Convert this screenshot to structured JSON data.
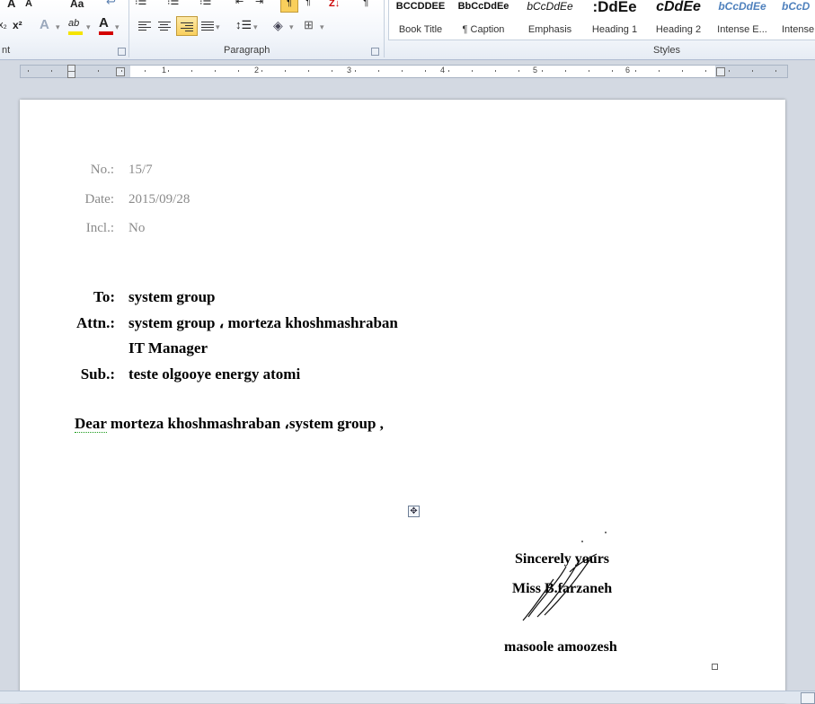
{
  "ribbon": {
    "font_group_label": "nt",
    "paragraph_group_label": "Paragraph",
    "styles_group_label": "Styles",
    "font_buttons": {
      "bold_a": "A",
      "shrink_a": "A",
      "change_case": "Aa",
      "subscript": "x₂",
      "superscript": "x²",
      "text_effects": "A",
      "highlight": "ab",
      "font_color": "A"
    },
    "sort": "Z↓",
    "styles": [
      {
        "sample": "BCCDDEE",
        "name": "Book Title"
      },
      {
        "sample": "BbCcDdEe",
        "name": "¶ Caption"
      },
      {
        "sample": "bCcDdEe",
        "name": "Emphasis"
      },
      {
        "sample": ":DdEe",
        "name": "Heading 1"
      },
      {
        "sample": "cDdEe",
        "name": "Heading 2"
      },
      {
        "sample": "bCcDdEe",
        "name": "Intense E..."
      },
      {
        "sample": "bCcD",
        "name": "Intense"
      }
    ]
  },
  "ruler": {
    "numbers": [
      "1",
      "2",
      "3",
      "4",
      "5",
      "6"
    ]
  },
  "document": {
    "meta": [
      {
        "label": "No.:",
        "value": "15/7"
      },
      {
        "label": "Date:",
        "value": "2015/09/28"
      },
      {
        "label": "Incl.:",
        "value": "No"
      }
    ],
    "header": {
      "to_label": "To:",
      "to_value": "system group",
      "attn_label": "Attn.:",
      "attn_value": "system group ، morteza khoshmashraban",
      "attn_role": "IT Manager",
      "sub_label": "Sub.:",
      "sub_value": "teste olgooye energy atomi"
    },
    "greeting_word": "Dear",
    "greeting_rest": " morteza khoshmashraban ،system group  ,",
    "signature": {
      "closing": "Sincerely yours",
      "name": "Miss B.farzaneh",
      "org": "masoole amoozesh"
    }
  },
  "colors": {
    "meta_text": "#8a8a8a",
    "highlight_yellow": "#f5e400",
    "font_color_red": "#d40000",
    "active_button": "#f9cf5c"
  }
}
